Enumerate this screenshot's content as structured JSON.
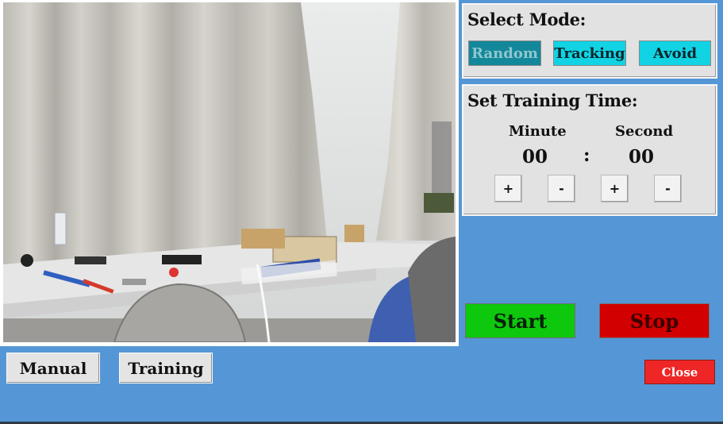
{
  "mode_panel": {
    "title": "Select Mode:",
    "buttons": {
      "random": "Random",
      "tracking": "Tracking",
      "avoid": "Avoid"
    },
    "selected": "Random"
  },
  "training_panel": {
    "title": "Set Training Time:",
    "minute_label": "Minute",
    "second_label": "Second",
    "minute_value": "00",
    "separator": ":",
    "second_value": "00",
    "minute_plus": "+",
    "minute_minus": "-",
    "second_plus": "+",
    "second_minus": "-"
  },
  "controls": {
    "start": "Start",
    "stop": "Stop",
    "close": "Close"
  },
  "nav": {
    "manual": "Manual",
    "training": "Training"
  },
  "colors": {
    "background": "#5597d6",
    "random_button": "#12889a",
    "mode_button": "#11d3e3",
    "start": "#0dc80d",
    "stop": "#d20000",
    "close": "#ee2626"
  }
}
